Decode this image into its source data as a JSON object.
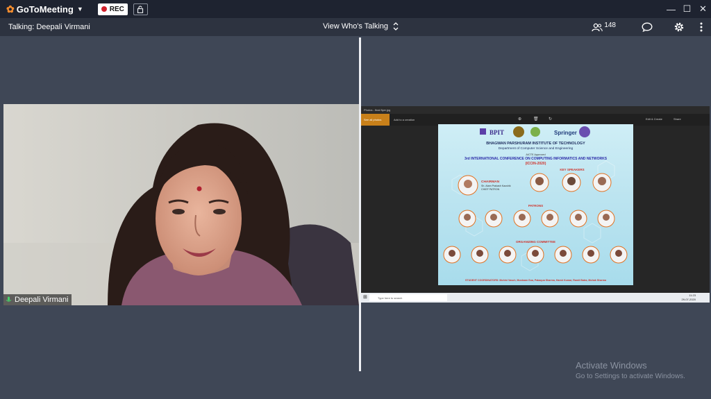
{
  "app": {
    "name": "GoToMeeting",
    "rec_label": "REC"
  },
  "infobar": {
    "talking": "Talking: Deepali Virmani",
    "view_whos_talking": "View Who's Talking",
    "attendee_count": "148"
  },
  "video": {
    "participant_name": "Deepali Virmani"
  },
  "share": {
    "window_title": "Photos - final flyer.jpg",
    "see_all_photos": "See all photos",
    "add_to_creation": "Add to a creation",
    "edit_create": "Edit & Create",
    "share": "Share",
    "poster": {
      "brand": "BPIT",
      "publisher": "Springer",
      "institute": "BHAGWAN PARSHURAM INSTITUTE OF TECHNOLOGY",
      "department": "Department of Computer Science and Engineering",
      "approved": "AICTE Approved",
      "conference": "3rd INTERNATIONAL CONFERENCE ON COMPUTING INFORMATICS AND NETWORKS",
      "acronym": "(ICCIN-2020)",
      "key_speakers": "KEY SPEAKERS",
      "chairman": "CHAIRMAN",
      "chairman_name": "Sh. Atam Prakash Kaushik",
      "chief_patron": "CHIEF PATRON",
      "patrons": "PATRONS",
      "organizing_committee": "ORGANIZING COMMITTEE",
      "student_coordinators": "STUDENT COORDINATORS: Mohini Vasuh, Muskaan Goa, Pakaqua Sharma, Harsh Kumar, Ramit Batra, Mohak Sharma"
    },
    "taskbar_search": "Type here to search",
    "time": "11:23",
    "date": "29-07-2020"
  },
  "watermark": {
    "line1": "Activate Windows",
    "line2": "Go to Settings to activate Windows."
  },
  "colors": {
    "titlebar": "#1e2330",
    "infobar": "#2d3340",
    "stage": "#3f4756",
    "accent": "#f68d2e",
    "rec_dot": "#d0202c"
  }
}
